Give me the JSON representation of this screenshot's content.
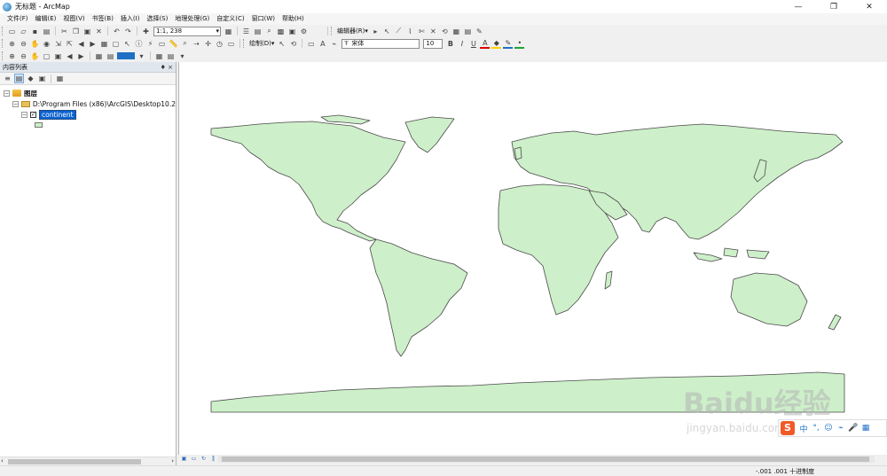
{
  "window": {
    "title": "无标题 - ArcMap",
    "minimize": "—",
    "maximize": "❐",
    "close": "✕"
  },
  "menu": [
    "文件(F)",
    "编辑(E)",
    "视图(V)",
    "书签(B)",
    "插入(I)",
    "选择(S)",
    "地理处理(G)",
    "自定义(C)",
    "窗口(W)",
    "帮助(H)"
  ],
  "toolbar": {
    "scale": "1:1, 238",
    "editor_label": "编辑器(R)▾",
    "draw_label": "绘制(D)▾",
    "font_name": "宋体",
    "font_size": "10",
    "bold": "B",
    "italic": "I",
    "underline": "U",
    "font_color_label": "A"
  },
  "toc": {
    "title": "内容列表",
    "pin": "♦ ×",
    "root_label": "图层",
    "path_label": "D:\\Program Files (x86)\\ArcGIS\\Desktop10.2",
    "layer_label": "continent",
    "layer_checked": "✓"
  },
  "status": {
    "coords": "-.001  .001 十进制度"
  },
  "ime": {
    "logo": "S",
    "items": [
      "中",
      "°,",
      "☺",
      "⌁",
      "🎤",
      "▦"
    ]
  },
  "watermark": {
    "main": "Baidu经验",
    "sub": "jingyan.baidu.com"
  },
  "colors": {
    "land": "#cdefc9",
    "land_stroke": "#4a4a4a",
    "selection": "#0b62d1"
  }
}
